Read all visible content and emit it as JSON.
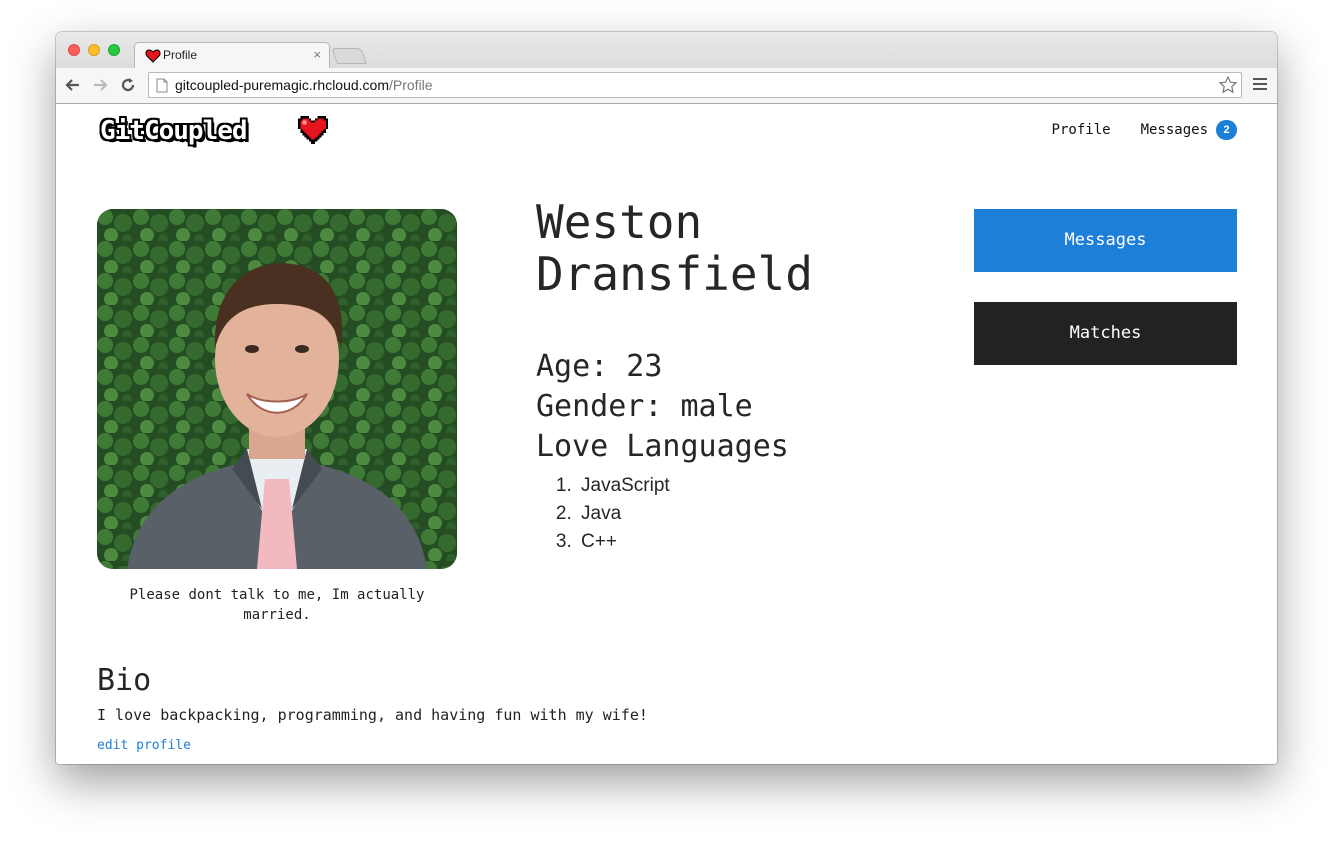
{
  "browser": {
    "tab_title": "Profile",
    "tab_close": "×",
    "url_host": "gitcoupled-puremagic.rhcloud.com",
    "url_path": "/Profile",
    "icons": [
      "heart-favicon-icon",
      "back-arrow-icon",
      "forward-arrow-icon",
      "reload-icon",
      "page-icon",
      "star-icon",
      "menu-icon"
    ]
  },
  "header": {
    "logo_text": "GitCoupled",
    "nav_profile": "Profile",
    "nav_messages": "Messages",
    "messages_badge": "2"
  },
  "profile": {
    "first_name": "Weston",
    "last_name": "Dransfield",
    "age_line": "Age: 23",
    "gender_line": "Gender: male",
    "love_languages_heading": "Love Languages",
    "love_languages": [
      "JavaScript",
      "Java",
      "C++"
    ],
    "photo_caption": "Please dont talk to me, Im actually married."
  },
  "actions": {
    "messages_label": "Messages",
    "matches_label": "Matches"
  },
  "bio": {
    "heading": "Bio",
    "text": "I love backpacking, programming, and having fun with my wife!",
    "edit_link": "edit profile"
  },
  "colors": {
    "accent_blue": "#1e7fd9",
    "dark_button": "#222222",
    "heart_red": "#e8141d"
  }
}
